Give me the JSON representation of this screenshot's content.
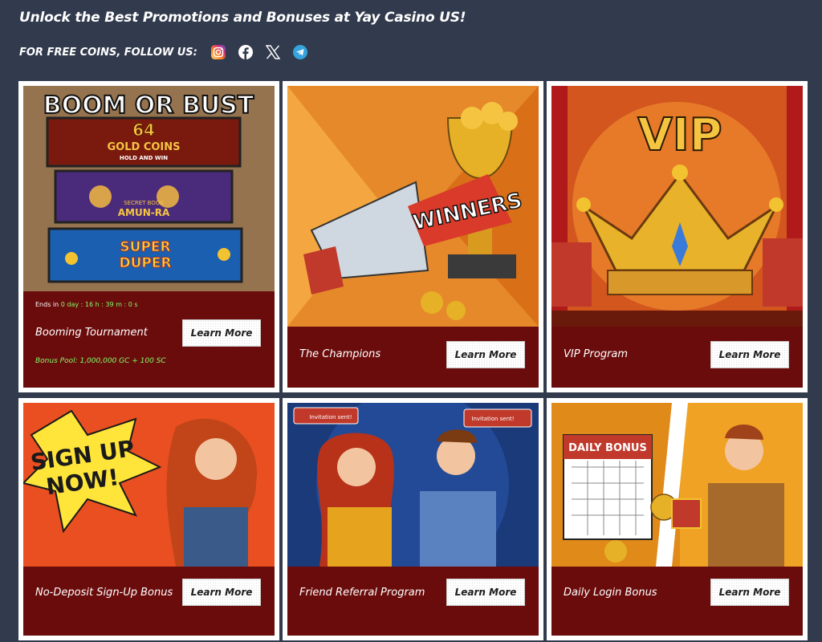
{
  "header": {
    "headline": "Unlock the Best Promotions and Bonuses at Yay Casino US!",
    "follow_label": "FOR FREE COINS, FOLLOW US:",
    "socials": [
      "instagram-icon",
      "facebook-icon",
      "x-icon",
      "telegram-icon"
    ]
  },
  "colors": {
    "page_bg": "#323a4d",
    "card_info_bg": "#6b0c0c",
    "timer_green": "#7fff6a"
  },
  "cards": [
    {
      "art_text": [
        "BOOM OR BUST",
        "64",
        "GOLD COINS",
        "HOLD AND WIN",
        "SECRET BOOK",
        "AMUN-RA",
        "SUPER",
        "DUPER"
      ],
      "ends_prefix": "Ends in",
      "ends_timer": "0 day : 16 h : 39 m : 0 s",
      "title": "Booming Tournament",
      "bonus_pool": "Bonus Pool: 1,000,000 GC + 100 SC",
      "button": "Learn More"
    },
    {
      "art_text": [
        "WINNERS"
      ],
      "title": "The Champions",
      "button": "Learn More"
    },
    {
      "art_text": [
        "VIP"
      ],
      "title": "VIP Program",
      "button": "Learn More"
    },
    {
      "art_text": [
        "SIGN UP",
        "NOW!"
      ],
      "title": "No-Deposit Sign-Up Bonus",
      "button": "Learn More"
    },
    {
      "art_text": [
        "Invitation sent!",
        "Invitation sent!"
      ],
      "title": "Friend Referral Program",
      "button": "Learn More"
    },
    {
      "art_text": [
        "DAILY BONUS"
      ],
      "title": "Daily Login Bonus",
      "button": "Learn More"
    }
  ]
}
